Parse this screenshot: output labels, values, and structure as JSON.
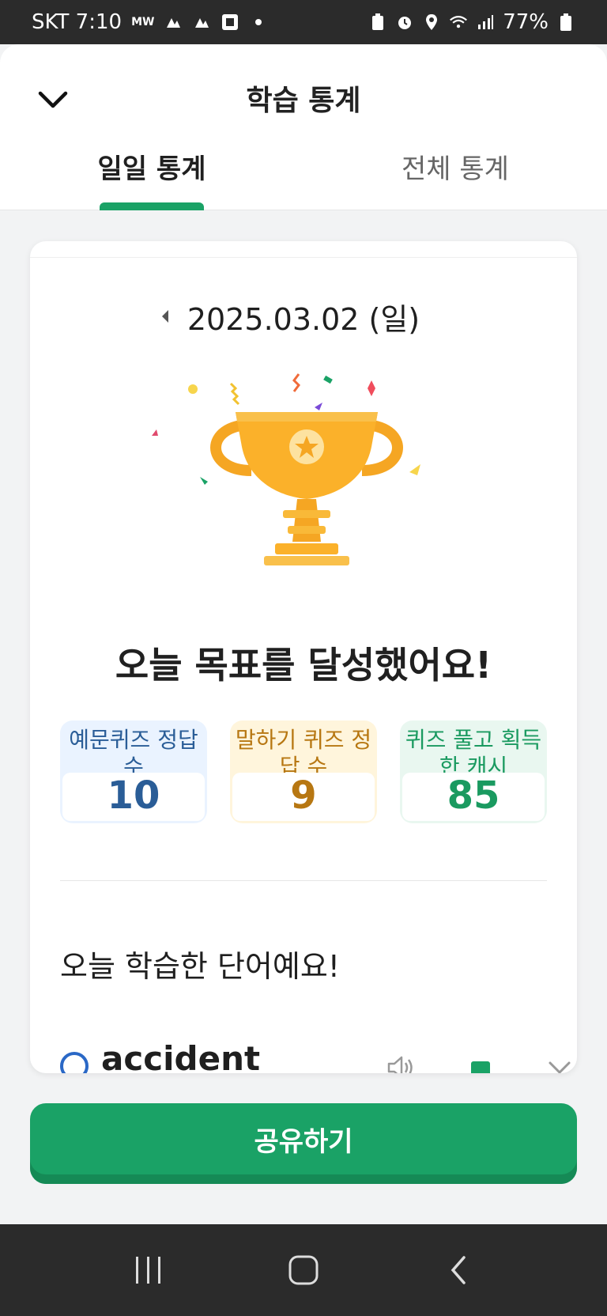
{
  "status_bar": {
    "carrier_time": "SKT 7:10",
    "mw": "MW",
    "battery": "77%",
    "icons": [
      "weather-icon",
      "weather-icon",
      "app-icon",
      "dot-icon",
      "battery-saver-icon",
      "alarm-icon",
      "location-icon",
      "wifi-icon",
      "signal-icon",
      "battery-icon"
    ]
  },
  "header": {
    "title": "학습 통계",
    "back_icon": "chevron-down-icon",
    "tabs": [
      {
        "label": "일일 통계",
        "active": true
      },
      {
        "label": "전체 통계",
        "active": false
      }
    ],
    "accent": "#1aa266"
  },
  "card": {
    "date": "2025.03.02 (일)",
    "headline": "오늘 목표를 달성했어요!",
    "stats": [
      {
        "label": "예문퀴즈 정답 수",
        "value": "10",
        "color": "#2a5d97"
      },
      {
        "label": "말하기 퀴즈 정답 수",
        "value": "9",
        "color": "#b77712"
      },
      {
        "label": "퀴즈 풀고 획득한 캐시",
        "value": "85",
        "color": "#1a9a60"
      }
    ],
    "section_title": "오늘 학습한 단어예요!",
    "words": [
      {
        "word": "accident"
      }
    ]
  },
  "share_button": {
    "label": "공유하기"
  },
  "nav_bar": {
    "icons": [
      "recents-icon",
      "home-icon",
      "back-icon"
    ]
  }
}
